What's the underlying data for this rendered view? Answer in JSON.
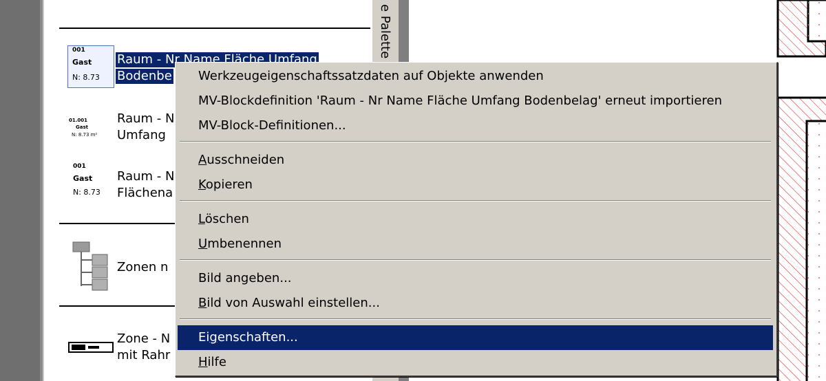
{
  "palette": {
    "title": "e Palette",
    "items": [
      {
        "icon": [
          "001",
          "Gast",
          "N: 8.73"
        ],
        "label_line1": "Raum - Nr Name Fläche Umfang",
        "label_line2": "Bodenbe"
      },
      {
        "icon": [
          "01.001",
          "Gast",
          "N: 8.73 m²"
        ],
        "label_line1": "Raum - N",
        "label_line2": "Umfang"
      },
      {
        "icon": [
          "001",
          "Gast",
          "N: 8.73"
        ],
        "label_line1": "Raum - N",
        "label_line2": "Flächena"
      },
      {
        "label_line1": "Zonen n"
      },
      {
        "label_line1": "Zone - N",
        "label_line2": "mit Rahr"
      }
    ]
  },
  "context_menu": {
    "group1": [
      "Werkzeugeigenschaftssatzdaten auf Objekte anwenden",
      "MV-Blockdefinition 'Raum - Nr Name Fläche Umfang Bodenbelag' erneut importieren",
      "MV-Block-Definitionen..."
    ],
    "group2": {
      "cut_u": "A",
      "cut_rest": "usschneiden",
      "copy_u": "K",
      "copy_rest": "opieren"
    },
    "group3": {
      "delete_u": "L",
      "delete_rest": "öschen",
      "rename_u": "U",
      "rename_rest": "mbenennen"
    },
    "group4": {
      "set_image": "Bild angeben...",
      "set_from_sel_u": "B",
      "set_from_sel_rest": "ild von Auswahl einstellen..."
    },
    "group5": {
      "props_pre": "Ei",
      "props_u": "g",
      "props_rest": "enschaften...",
      "help_u": "H",
      "help_rest": "ilfe"
    }
  },
  "colors": {
    "selection": "#0a246a",
    "menu_bg": "#d4d0c8",
    "hatch": "#e03030"
  }
}
